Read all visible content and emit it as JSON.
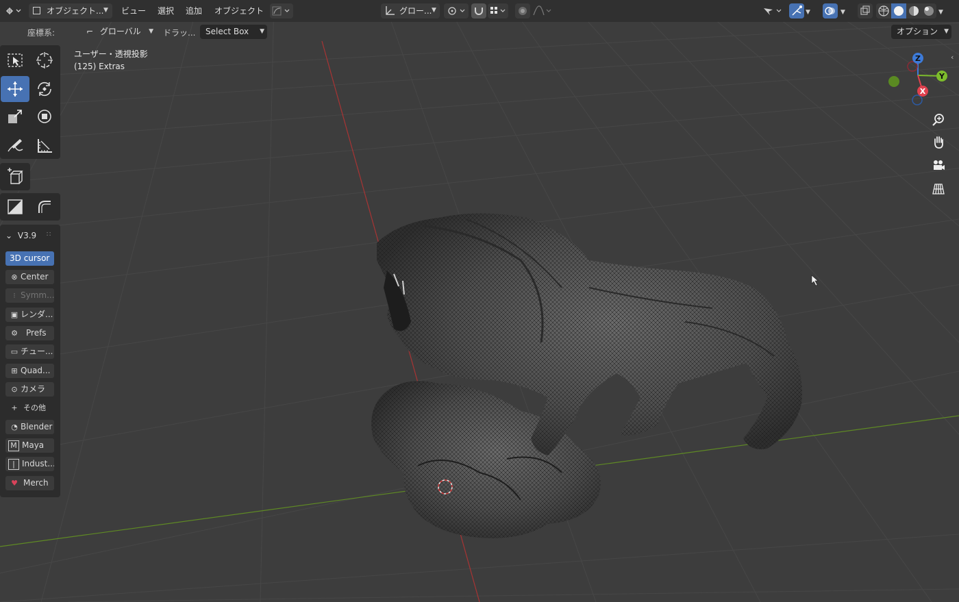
{
  "header": {
    "mode_label": "オブジェクト...",
    "menus": [
      "ビュー",
      "選択",
      "追加",
      "オブジェクト"
    ],
    "transform_orientation": "グロー...",
    "options_label": "オプション"
  },
  "subbar": {
    "coord_label": "座標系:",
    "coord_value": "グローバル",
    "drag_label": "ドラッ...",
    "drag_value": "Select Box"
  },
  "viewport": {
    "view_name": "ユーザー・透視投影",
    "collection_info": "(125) Extras"
  },
  "gizmo": {
    "z": "Z",
    "y": "Y",
    "x": "X"
  },
  "panel": {
    "title": "V3.9",
    "buttons": [
      {
        "label": "3D cursor",
        "icon": "",
        "state": "active"
      },
      {
        "label": "Center",
        "icon": "center-icon",
        "state": "normal"
      },
      {
        "label": "Symm...",
        "icon": "symmetry-icon",
        "state": "disabled"
      },
      {
        "label": "レンダ...",
        "icon": "render-icon",
        "state": "normal"
      },
      {
        "label": "Prefs",
        "icon": "gear-icon",
        "state": "normal"
      },
      {
        "label": "チュー...",
        "icon": "tutorial-icon",
        "state": "normal"
      },
      {
        "label": "Quad...",
        "icon": "quad-icon",
        "state": "normal"
      },
      {
        "label": "カメラ",
        "icon": "camera-icon",
        "state": "normal"
      },
      {
        "label": "その他",
        "icon": "plus-icon",
        "state": "flat"
      },
      {
        "label": "Blender",
        "icon": "blender-icon",
        "state": "normal"
      },
      {
        "label": "Maya",
        "icon": "maya-icon",
        "state": "normal"
      },
      {
        "label": "Indust...",
        "icon": "industry-icon",
        "state": "normal"
      },
      {
        "label": "Merch",
        "icon": "heart-icon",
        "state": "normal"
      }
    ]
  },
  "colors": {
    "accent": "#4772b3",
    "x_axis": "#c43b3b",
    "y_axis": "#6f9a2a",
    "gizmo_z": "#3d7bd9",
    "gizmo_y": "#7dbc2c",
    "gizmo_x": "#e0414e"
  }
}
